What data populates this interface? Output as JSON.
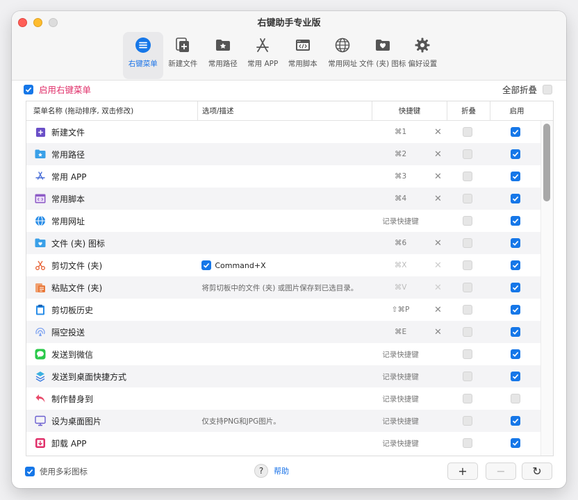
{
  "window": {
    "title": "右键助手专业版"
  },
  "toolbar": {
    "items": [
      {
        "label": "右键菜单",
        "icon": "menu-list-icon",
        "active": true
      },
      {
        "label": "新建文件",
        "icon": "new-file-icon"
      },
      {
        "label": "常用路径",
        "icon": "folder-star-icon"
      },
      {
        "label": "常用 APP",
        "icon": "app-store-icon"
      },
      {
        "label": "常用脚本",
        "icon": "script-icon"
      },
      {
        "label": "常用网址",
        "icon": "globe-icon"
      },
      {
        "label": "文件 (夹) 图标",
        "icon": "folder-heart-icon"
      },
      {
        "label": "偏好设置",
        "icon": "gear-icon"
      }
    ]
  },
  "enable_menu": {
    "label": "启用右键菜单",
    "checked": true
  },
  "collapse_all": {
    "label": "全部折叠",
    "checked": false
  },
  "table": {
    "headers": {
      "name": "菜单名称 (拖动排序, 双击修改)",
      "option": "选项/描述",
      "shortcut": "快捷键",
      "fold": "折叠",
      "enable": "启用"
    },
    "rows": [
      {
        "name": "新建文件",
        "icon": "new-file-icon",
        "option": "",
        "shortcut": "⌘1",
        "clear": true,
        "enabled": true
      },
      {
        "name": "常用路径",
        "icon": "folder-icon",
        "option": "",
        "shortcut": "⌘2",
        "clear": true,
        "enabled": true
      },
      {
        "name": "常用 APP",
        "icon": "app-store-icon",
        "option": "",
        "shortcut": "⌘3",
        "clear": true,
        "enabled": true
      },
      {
        "name": "常用脚本",
        "icon": "script-icon",
        "option": "",
        "shortcut": "⌘4",
        "clear": true,
        "enabled": true
      },
      {
        "name": "常用网址",
        "icon": "globe-icon",
        "option": "",
        "shortcut": "记录快捷键",
        "clear": false,
        "enabled": true
      },
      {
        "name": "文件 (夹) 图标",
        "icon": "folder-heart-icon",
        "option": "",
        "shortcut": "⌘6",
        "clear": true,
        "enabled": true
      },
      {
        "name": "剪切文件 (夹)",
        "icon": "scissors-icon",
        "option_checkbox": true,
        "option": "Command+X",
        "shortcut": "⌘X",
        "shortcut_dim": true,
        "clear": true,
        "clear_dim": true,
        "enabled": true
      },
      {
        "name": "粘贴文件 (夹)",
        "icon": "paste-icon",
        "option": "将剪切板中的文件 (夹) 或图片保存到已选目录。",
        "shortcut": "⌘V",
        "shortcut_dim": true,
        "clear": true,
        "clear_dim": true,
        "enabled": true
      },
      {
        "name": "剪切板历史",
        "icon": "clipboard-icon",
        "option": "",
        "shortcut": "⇧⌘P",
        "clear": true,
        "enabled": true
      },
      {
        "name": "隔空投送",
        "icon": "airdrop-icon",
        "option": "",
        "shortcut": "⌘E",
        "clear": true,
        "enabled": true
      },
      {
        "name": "发送到微信",
        "icon": "wechat-icon",
        "option": "",
        "shortcut": "记录快捷键",
        "clear": false,
        "enabled": true
      },
      {
        "name": "发送到桌面快捷方式",
        "icon": "shortcut-icon",
        "option": "",
        "shortcut": "记录快捷键",
        "clear": false,
        "enabled": true
      },
      {
        "name": "制作替身到",
        "icon": "alias-arrow-icon",
        "option": "",
        "shortcut": "记录快捷键",
        "clear": false,
        "enabled": false
      },
      {
        "name": "设为桌面图片",
        "icon": "monitor-icon",
        "option": "仅支持PNG和JPG图片。",
        "shortcut": "记录快捷键",
        "clear": false,
        "enabled": true
      },
      {
        "name": "卸载 APP",
        "icon": "uninstall-icon",
        "option": "",
        "shortcut": "记录快捷键",
        "clear": false,
        "enabled": true
      }
    ]
  },
  "footer": {
    "colorful_icons": {
      "label": "使用多彩图标",
      "checked": true
    },
    "help": {
      "symbol": "?",
      "label": "帮助"
    },
    "add": "+",
    "remove": "−",
    "refresh": "↻"
  },
  "colors": {
    "accent": "#1677e8",
    "enable_label": "#e0306a",
    "link": "#1a73e8"
  }
}
